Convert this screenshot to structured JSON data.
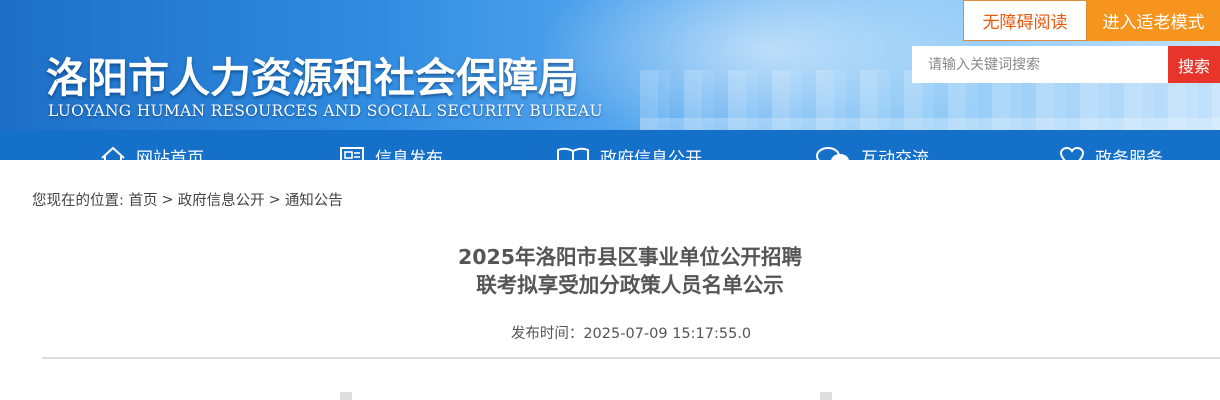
{
  "header": {
    "site_title": "洛阳市人力资源和社会保障局",
    "site_subtitle": "LUOYANG HUMAN RESOURCES AND SOCIAL SECURITY BUREAU",
    "barrier_free_label": "无障碍阅读",
    "elder_mode_label": "进入适老模式",
    "search": {
      "placeholder": "请输入关键词搜索",
      "button_label": "搜索"
    }
  },
  "nav": {
    "items": [
      {
        "label": "网站首页",
        "icon": "home-icon"
      },
      {
        "label": "信息发布",
        "icon": "newspaper-icon"
      },
      {
        "label": "政府信息公开",
        "icon": "book-icon"
      },
      {
        "label": "互动交流",
        "icon": "chat-bubbles-icon"
      },
      {
        "label": "政务服务",
        "icon": "heart-icon"
      }
    ]
  },
  "breadcrumb": {
    "prefix": "您现在的位置: ",
    "items": [
      "首页",
      "政府信息公开",
      "通知公告"
    ],
    "separator": ">"
  },
  "article": {
    "title_line1": "2025年洛阳市县区事业单位公开招聘",
    "title_line2": "联考拟享受加分政策人员名单公示",
    "publish_label": "发布时间：",
    "publish_time": "2025-07-09 15:17:55.0"
  },
  "colors": {
    "banner_blue": "#1d6fc6",
    "nav_blue": "#1470c8",
    "elder_orange": "#f7941d",
    "search_red": "#e8352b"
  }
}
